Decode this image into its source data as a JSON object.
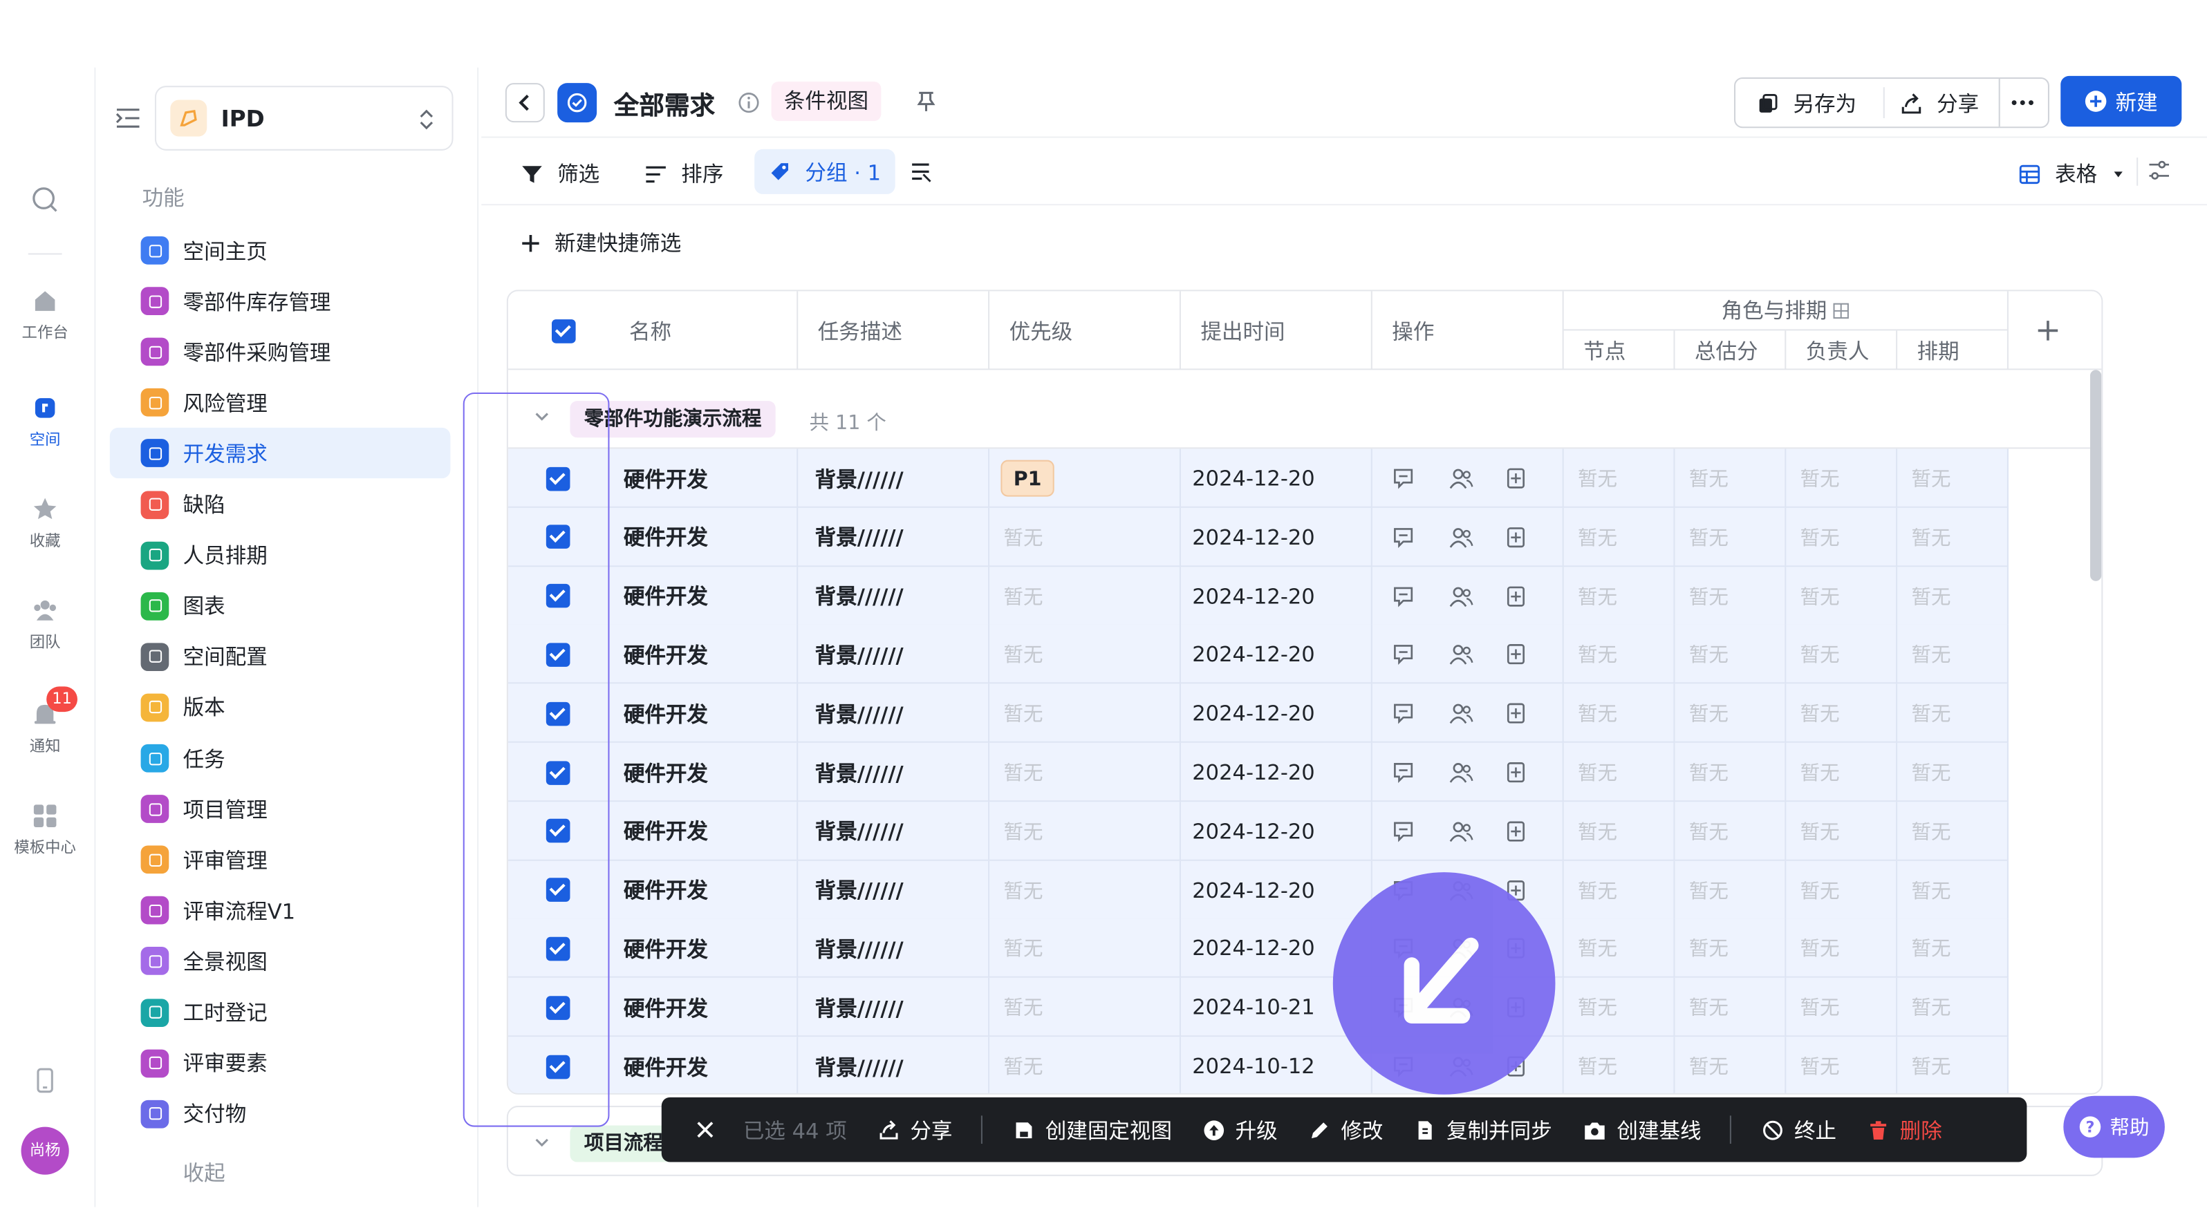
{
  "rail": {
    "items": [
      {
        "label": "",
        "icon": "search-icon"
      },
      {
        "label": "工作台",
        "icon": "home-icon"
      },
      {
        "label": "空间",
        "icon": "space-icon",
        "active": true
      },
      {
        "label": "收藏",
        "icon": "star-icon"
      },
      {
        "label": "团队",
        "icon": "team-icon"
      },
      {
        "label": "通知",
        "icon": "bell-icon",
        "badge": "11"
      },
      {
        "label": "模板中心",
        "icon": "template-icon"
      }
    ],
    "avatar": "尚杨"
  },
  "sidebar": {
    "space_name": "IPD",
    "section": "功能",
    "collapse_label": "收起",
    "items": [
      {
        "label": "空间主页",
        "color": "#3f7cf2"
      },
      {
        "label": "零部件库存管理",
        "color": "#b34bc8"
      },
      {
        "label": "零部件采购管理",
        "color": "#b34bc8"
      },
      {
        "label": "风险管理",
        "color": "#f5a33a"
      },
      {
        "label": "开发需求",
        "color": "#1b5fe0",
        "active": true
      },
      {
        "label": "缺陷",
        "color": "#f15b50"
      },
      {
        "label": "人员排期",
        "color": "#1aa682"
      },
      {
        "label": "图表",
        "color": "#2bb84a"
      },
      {
        "label": "空间配置",
        "color": "#646a73"
      },
      {
        "label": "版本",
        "color": "#f5b53a"
      },
      {
        "label": "任务",
        "color": "#28a8e6"
      },
      {
        "label": "项目管理",
        "color": "#b34bc8"
      },
      {
        "label": "评审管理",
        "color": "#f5a33a"
      },
      {
        "label": "评审流程V1",
        "color": "#b34bc8"
      },
      {
        "label": "全景视图",
        "color": "#a46be8"
      },
      {
        "label": "工时登记",
        "color": "#1aa6a6"
      },
      {
        "label": "评审要素",
        "color": "#b34bc8"
      },
      {
        "label": "交付物",
        "color": "#6b6be8"
      }
    ]
  },
  "header": {
    "title": "全部需求",
    "view_tag": "条件视图",
    "save_as": "另存为",
    "share": "分享",
    "new": "新建"
  },
  "toolbar": {
    "filter": "筛选",
    "sort": "排序",
    "group": "分组 · 1",
    "view_mode": "表格",
    "quick_filter": "新建快捷筛选"
  },
  "table": {
    "columns": [
      "名称",
      "任务描述",
      "优先级",
      "提出时间",
      "操作"
    ],
    "group_header": "角色与排期",
    "sub_columns": [
      "节点",
      "总估分",
      "负责人",
      "排期"
    ],
    "group": {
      "name": "零部件功能演示流程",
      "count": "共 11 个"
    },
    "group2": {
      "name": "项目流程"
    },
    "empty": "暂无",
    "rows": [
      {
        "name": "硬件开发",
        "desc": "背景//////",
        "priority": "P1",
        "date": "2024-12-20"
      },
      {
        "name": "硬件开发",
        "desc": "背景//////",
        "priority": "",
        "date": "2024-12-20"
      },
      {
        "name": "硬件开发",
        "desc": "背景//////",
        "priority": "",
        "date": "2024-12-20"
      },
      {
        "name": "硬件开发",
        "desc": "背景//////",
        "priority": "",
        "date": "2024-12-20"
      },
      {
        "name": "硬件开发",
        "desc": "背景//////",
        "priority": "",
        "date": "2024-12-20"
      },
      {
        "name": "硬件开发",
        "desc": "背景//////",
        "priority": "",
        "date": "2024-12-20"
      },
      {
        "name": "硬件开发",
        "desc": "背景//////",
        "priority": "",
        "date": "2024-12-20"
      },
      {
        "name": "硬件开发",
        "desc": "背景//////",
        "priority": "",
        "date": "2024-12-20"
      },
      {
        "name": "硬件开发",
        "desc": "背景//////",
        "priority": "",
        "date": "2024-12-20"
      },
      {
        "name": "硬件开发",
        "desc": "背景//////",
        "priority": "",
        "date": "2024-10-21"
      },
      {
        "name": "硬件开发",
        "desc": "背景//////",
        "priority": "",
        "date": "2024-10-12"
      }
    ]
  },
  "action_bar": {
    "selected": "已选 44 项",
    "items": [
      {
        "label": "分享",
        "icon": "share-icon"
      },
      {
        "label": "创建固定视图",
        "icon": "save-icon"
      },
      {
        "label": "升级",
        "icon": "upgrade-icon"
      },
      {
        "label": "修改",
        "icon": "edit-icon"
      },
      {
        "label": "复制并同步",
        "icon": "copy-icon"
      },
      {
        "label": "创建基线",
        "icon": "camera-icon"
      },
      {
        "label": "终止",
        "icon": "stop-icon"
      },
      {
        "label": "删除",
        "icon": "trash-icon",
        "danger": true
      }
    ]
  },
  "help": "帮助",
  "colors": {
    "accent": "#1b5fe0",
    "selection": "#eef3fe",
    "cursor": "#7b6cf0",
    "danger": "#f54a45"
  }
}
